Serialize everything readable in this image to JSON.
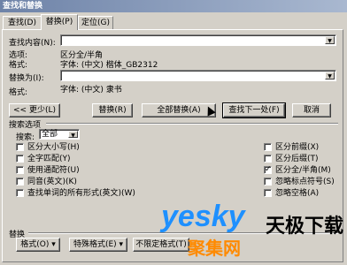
{
  "window": {
    "title": "查找和替换"
  },
  "tabs": [
    {
      "label": "查找(D)"
    },
    {
      "label": "替换(P)"
    },
    {
      "label": "定位(G)"
    }
  ],
  "find": {
    "label": "查找内容(N):",
    "value": "",
    "options_label": "选项:",
    "options_value": "区分全/半角",
    "format_label": "格式:",
    "format_value": "字体: (中文) 楷体_GB2312"
  },
  "replace": {
    "label": "替换为(I):",
    "value": "",
    "format_label": "格式:",
    "format_value": "字体: (中文) 隶书"
  },
  "buttons": {
    "less": "<< 更少(L)",
    "replace": "替换(R)",
    "replace_all": "全部替换(A)",
    "find_next": "查找下一处(F)",
    "cancel": "取消"
  },
  "search_options": {
    "section_title": "搜索选项",
    "search_label": "搜索:",
    "search_value": "全部",
    "left": [
      {
        "label": "区分大小写(H)",
        "checked": false
      },
      {
        "label": "全字匹配(Y)",
        "checked": false
      },
      {
        "label": "使用通配符(U)",
        "checked": false
      },
      {
        "label": "同音(英文)(K)",
        "checked": false
      },
      {
        "label": "查找单词的所有形式(英文)(W)",
        "checked": false
      }
    ],
    "right": [
      {
        "label": "区分前缀(X)",
        "checked": false
      },
      {
        "label": "区分后缀(T)",
        "checked": false
      },
      {
        "label": "区分全/半角(M)",
        "checked": true
      },
      {
        "label": "忽略标点符号(S)",
        "checked": false
      },
      {
        "label": "忽略空格(A)",
        "checked": false
      }
    ]
  },
  "replace_section": {
    "title": "替换",
    "format_btn": "格式(O) ▾",
    "special_btn": "特殊格式(E) ▾",
    "noformat_btn": "不限定格式(T)"
  },
  "watermark": {
    "brand": "yesky",
    "cn": "天极下载",
    "sub": "聚集网",
    "brand_color": "#1e90ff",
    "accent_color": "#ff8a00"
  }
}
